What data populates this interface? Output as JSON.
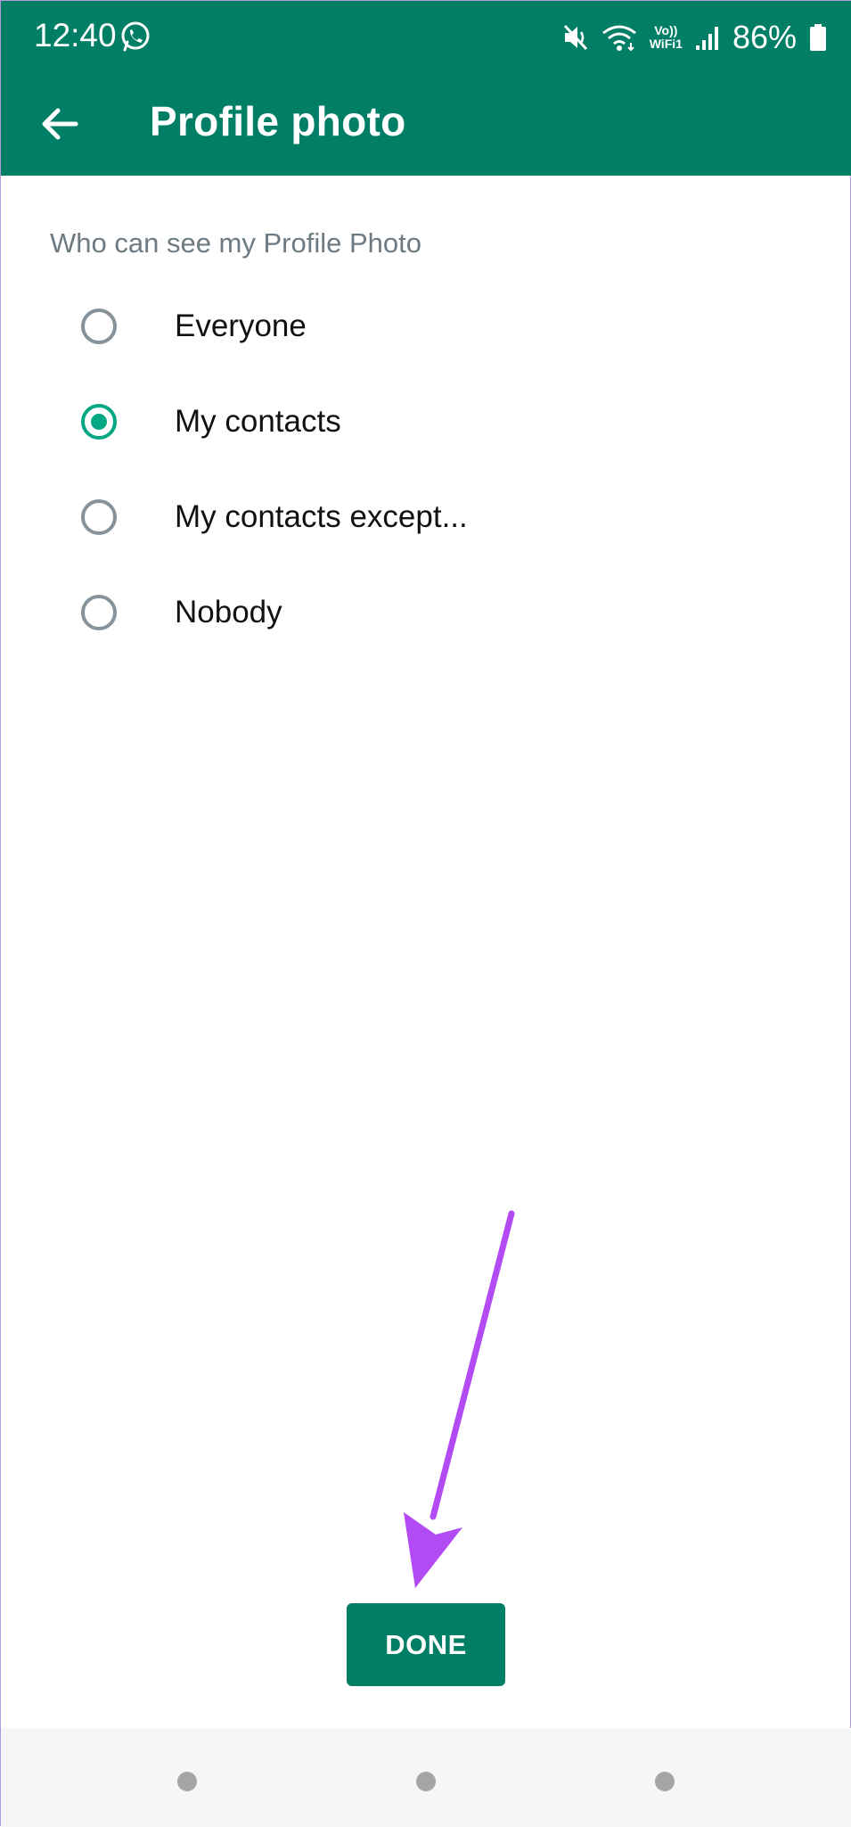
{
  "status_bar": {
    "time": "12:40",
    "battery": "86%",
    "volte_line1": "Vo))",
    "volte_line2": "WiFi1",
    "icons": [
      "whatsapp-icon",
      "mute-icon",
      "wifi-icon",
      "signal-icon",
      "battery-icon"
    ]
  },
  "toolbar": {
    "title": "Profile photo",
    "back_icon": "arrow-back-icon"
  },
  "settings": {
    "section_label": "Who can see my Profile Photo",
    "options": [
      {
        "label": "Everyone",
        "selected": false
      },
      {
        "label": "My contacts",
        "selected": true
      },
      {
        "label": "My contacts except...",
        "selected": false
      },
      {
        "label": "Nobody",
        "selected": false
      }
    ]
  },
  "done_label": "DONE",
  "colors": {
    "primary": "#017e66",
    "accent": "#02a884",
    "annotation_arrow": "#b34bf5"
  }
}
